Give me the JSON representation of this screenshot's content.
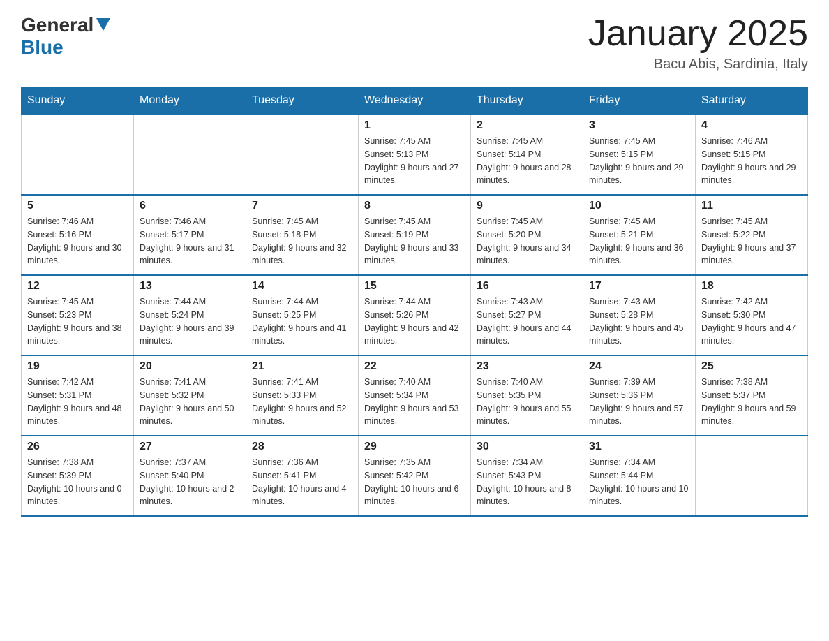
{
  "header": {
    "logo": {
      "general": "General",
      "blue": "Blue"
    },
    "title": "January 2025",
    "location": "Bacu Abis, Sardinia, Italy"
  },
  "days_of_week": [
    "Sunday",
    "Monday",
    "Tuesday",
    "Wednesday",
    "Thursday",
    "Friday",
    "Saturday"
  ],
  "weeks": [
    [
      {
        "day": "",
        "info": ""
      },
      {
        "day": "",
        "info": ""
      },
      {
        "day": "",
        "info": ""
      },
      {
        "day": "1",
        "info": "Sunrise: 7:45 AM\nSunset: 5:13 PM\nDaylight: 9 hours and 27 minutes."
      },
      {
        "day": "2",
        "info": "Sunrise: 7:45 AM\nSunset: 5:14 PM\nDaylight: 9 hours and 28 minutes."
      },
      {
        "day": "3",
        "info": "Sunrise: 7:45 AM\nSunset: 5:15 PM\nDaylight: 9 hours and 29 minutes."
      },
      {
        "day": "4",
        "info": "Sunrise: 7:46 AM\nSunset: 5:15 PM\nDaylight: 9 hours and 29 minutes."
      }
    ],
    [
      {
        "day": "5",
        "info": "Sunrise: 7:46 AM\nSunset: 5:16 PM\nDaylight: 9 hours and 30 minutes."
      },
      {
        "day": "6",
        "info": "Sunrise: 7:46 AM\nSunset: 5:17 PM\nDaylight: 9 hours and 31 minutes."
      },
      {
        "day": "7",
        "info": "Sunrise: 7:45 AM\nSunset: 5:18 PM\nDaylight: 9 hours and 32 minutes."
      },
      {
        "day": "8",
        "info": "Sunrise: 7:45 AM\nSunset: 5:19 PM\nDaylight: 9 hours and 33 minutes."
      },
      {
        "day": "9",
        "info": "Sunrise: 7:45 AM\nSunset: 5:20 PM\nDaylight: 9 hours and 34 minutes."
      },
      {
        "day": "10",
        "info": "Sunrise: 7:45 AM\nSunset: 5:21 PM\nDaylight: 9 hours and 36 minutes."
      },
      {
        "day": "11",
        "info": "Sunrise: 7:45 AM\nSunset: 5:22 PM\nDaylight: 9 hours and 37 minutes."
      }
    ],
    [
      {
        "day": "12",
        "info": "Sunrise: 7:45 AM\nSunset: 5:23 PM\nDaylight: 9 hours and 38 minutes."
      },
      {
        "day": "13",
        "info": "Sunrise: 7:44 AM\nSunset: 5:24 PM\nDaylight: 9 hours and 39 minutes."
      },
      {
        "day": "14",
        "info": "Sunrise: 7:44 AM\nSunset: 5:25 PM\nDaylight: 9 hours and 41 minutes."
      },
      {
        "day": "15",
        "info": "Sunrise: 7:44 AM\nSunset: 5:26 PM\nDaylight: 9 hours and 42 minutes."
      },
      {
        "day": "16",
        "info": "Sunrise: 7:43 AM\nSunset: 5:27 PM\nDaylight: 9 hours and 44 minutes."
      },
      {
        "day": "17",
        "info": "Sunrise: 7:43 AM\nSunset: 5:28 PM\nDaylight: 9 hours and 45 minutes."
      },
      {
        "day": "18",
        "info": "Sunrise: 7:42 AM\nSunset: 5:30 PM\nDaylight: 9 hours and 47 minutes."
      }
    ],
    [
      {
        "day": "19",
        "info": "Sunrise: 7:42 AM\nSunset: 5:31 PM\nDaylight: 9 hours and 48 minutes."
      },
      {
        "day": "20",
        "info": "Sunrise: 7:41 AM\nSunset: 5:32 PM\nDaylight: 9 hours and 50 minutes."
      },
      {
        "day": "21",
        "info": "Sunrise: 7:41 AM\nSunset: 5:33 PM\nDaylight: 9 hours and 52 minutes."
      },
      {
        "day": "22",
        "info": "Sunrise: 7:40 AM\nSunset: 5:34 PM\nDaylight: 9 hours and 53 minutes."
      },
      {
        "day": "23",
        "info": "Sunrise: 7:40 AM\nSunset: 5:35 PM\nDaylight: 9 hours and 55 minutes."
      },
      {
        "day": "24",
        "info": "Sunrise: 7:39 AM\nSunset: 5:36 PM\nDaylight: 9 hours and 57 minutes."
      },
      {
        "day": "25",
        "info": "Sunrise: 7:38 AM\nSunset: 5:37 PM\nDaylight: 9 hours and 59 minutes."
      }
    ],
    [
      {
        "day": "26",
        "info": "Sunrise: 7:38 AM\nSunset: 5:39 PM\nDaylight: 10 hours and 0 minutes."
      },
      {
        "day": "27",
        "info": "Sunrise: 7:37 AM\nSunset: 5:40 PM\nDaylight: 10 hours and 2 minutes."
      },
      {
        "day": "28",
        "info": "Sunrise: 7:36 AM\nSunset: 5:41 PM\nDaylight: 10 hours and 4 minutes."
      },
      {
        "day": "29",
        "info": "Sunrise: 7:35 AM\nSunset: 5:42 PM\nDaylight: 10 hours and 6 minutes."
      },
      {
        "day": "30",
        "info": "Sunrise: 7:34 AM\nSunset: 5:43 PM\nDaylight: 10 hours and 8 minutes."
      },
      {
        "day": "31",
        "info": "Sunrise: 7:34 AM\nSunset: 5:44 PM\nDaylight: 10 hours and 10 minutes."
      },
      {
        "day": "",
        "info": ""
      }
    ]
  ]
}
